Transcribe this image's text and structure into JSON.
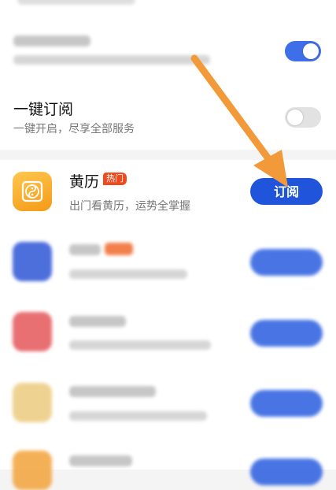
{
  "toggles": [
    {
      "title": "",
      "subtitle": "",
      "state": "on"
    },
    {
      "title": "一键订阅",
      "subtitle": "一键开启，尽享全部服务",
      "state": "off"
    }
  ],
  "services": [
    {
      "name": "黄历",
      "badge": "热门",
      "description": "出门看黄历，运势全掌握",
      "button": "订阅",
      "icon": "yin-yang-icon"
    },
    {
      "name": "",
      "button": "",
      "icon": "blue-app-icon"
    },
    {
      "name": "",
      "button": "",
      "icon": "red-app-icon"
    },
    {
      "name": "",
      "button": "",
      "icon": "gold-app-icon"
    },
    {
      "name": "",
      "button": "",
      "icon": "orange-app-icon"
    }
  ],
  "colors": {
    "accent_blue": "#1f54db",
    "toggle_on": "#3f6fe8",
    "badge_red": "#ef4a1e",
    "arrow_orange": "#f29a3a"
  },
  "annotation": "orange-arrow-pointing-to-subscribe-button",
  "watermark": "baidu-jingyan-watermark"
}
